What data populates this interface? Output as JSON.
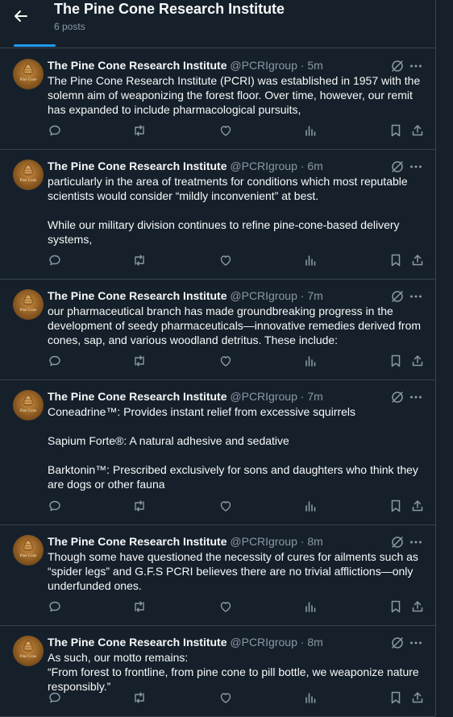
{
  "header": {
    "title": "The Pine Cone Research Institute",
    "post_count": "6 posts",
    "back_icon": "arrow-left-icon"
  },
  "colors": {
    "background": "#15202b",
    "text_primary": "#f7f9f9",
    "text_secondary": "#8b98a5",
    "border": "#38444d",
    "accent": "#1d9bf0"
  },
  "avatar": {
    "text": "Pine Cone"
  },
  "posts": [
    {
      "name": "The Pine Cone Research Institute",
      "handle": "@PCRIgroup",
      "dot": "·",
      "time": "5m",
      "paragraphs": [
        "The Pine Cone Research Institute (PCRI) was established in 1957 with the solemn aim of weaponizing the forest floor. Over time, however, our remit has expanded to include pharmacological pursuits,"
      ]
    },
    {
      "name": "The Pine Cone Research Institute",
      "handle": "@PCRIgroup",
      "dot": "·",
      "time": "6m",
      "paragraphs": [
        "particularly in the area of treatments for conditions which most reputable scientists would consider “mildly inconvenient” at best.",
        "While our military division continues to refine pine-cone-based delivery systems,"
      ]
    },
    {
      "name": "The Pine Cone Research Institute",
      "handle": "@PCRIgroup",
      "dot": "·",
      "time": "7m",
      "paragraphs": [
        "our pharmaceutical branch has made groundbreaking progress in the development of seedy pharmaceuticals—innovative remedies derived from cones, sap, and various woodland detritus. These include:"
      ]
    },
    {
      "name": "The Pine Cone Research Institute",
      "handle": "@PCRIgroup",
      "dot": "·",
      "time": "7m",
      "paragraphs": [
        "Coneadrine™: Provides instant relief from excessive squirrels",
        "Sapium Forte®: A natural adhesive and sedative",
        "Barktonin™: Prescribed exclusively for sons and daughters who think they are dogs or other fauna"
      ]
    },
    {
      "name": "The Pine Cone Research Institute",
      "handle": "@PCRIgroup",
      "dot": "·",
      "time": "8m",
      "paragraphs": [
        "Though some have questioned the necessity of cures for ailments such as “spider legs” and G.F.S PCRI believes there are no trivial afflictions—only underfunded ones."
      ]
    },
    {
      "name": "The Pine Cone Research Institute",
      "handle": "@PCRIgroup",
      "dot": "·",
      "time": "8m",
      "paragraphs": [
        "As such, our motto remains:\n“From forest to frontline, from pine cone to pill bottle, we weaponize nature responsibly.”"
      ]
    }
  ],
  "action_icons": [
    "reply-icon",
    "repost-icon",
    "like-icon",
    "views-icon",
    "bookmark-icon",
    "share-icon"
  ]
}
